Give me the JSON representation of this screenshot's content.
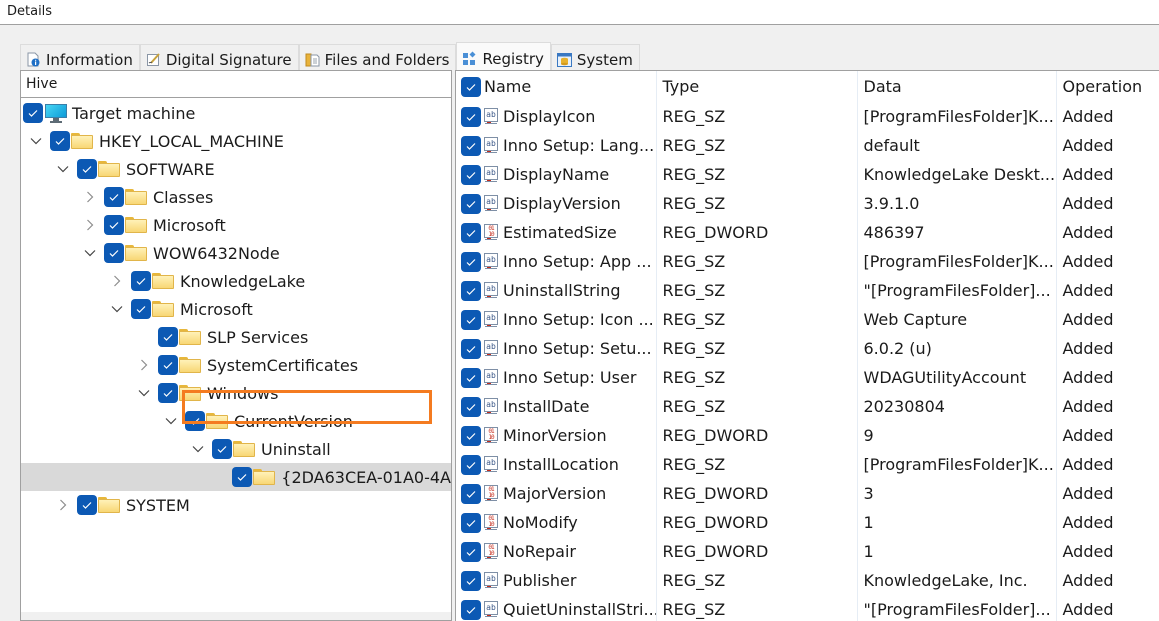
{
  "window": {
    "title": "Details"
  },
  "tabs": [
    {
      "label": "Information",
      "icon": "info-document-icon",
      "active": false
    },
    {
      "label": "Digital Signature",
      "icon": "signature-icon",
      "active": false
    },
    {
      "label": "Files and Folders",
      "icon": "files-folders-icon",
      "active": false
    },
    {
      "label": "Registry",
      "icon": "registry-icon",
      "active": true
    },
    {
      "label": "System",
      "icon": "system-database-icon",
      "active": false
    }
  ],
  "hive": {
    "header": "Hive",
    "nodes": [
      {
        "label": "Target machine",
        "level": 0,
        "expander": "none",
        "icon": "monitor-icon",
        "checked": true
      },
      {
        "label": "HKEY_LOCAL_MACHINE",
        "level": 1,
        "expander": "expanded",
        "icon": "folder-icon",
        "checked": true
      },
      {
        "label": "SOFTWARE",
        "level": 2,
        "expander": "expanded",
        "icon": "folder-icon",
        "checked": true
      },
      {
        "label": "Classes",
        "level": 3,
        "expander": "collapsed",
        "icon": "folder-icon",
        "checked": true
      },
      {
        "label": "Microsoft",
        "level": 3,
        "expander": "collapsed",
        "icon": "folder-icon",
        "checked": true
      },
      {
        "label": "WOW6432Node",
        "level": 3,
        "expander": "expanded",
        "icon": "folder-icon",
        "checked": true
      },
      {
        "label": "KnowledgeLake",
        "level": 4,
        "expander": "collapsed",
        "icon": "folder-icon",
        "checked": true
      },
      {
        "label": "Microsoft",
        "level": 4,
        "expander": "expanded",
        "icon": "folder-icon",
        "checked": true
      },
      {
        "label": "SLP Services",
        "level": 5,
        "expander": "none",
        "icon": "folder-icon",
        "checked": true
      },
      {
        "label": "SystemCertificates",
        "level": 5,
        "expander": "collapsed",
        "icon": "folder-icon",
        "checked": true
      },
      {
        "label": "Windows",
        "level": 5,
        "expander": "expanded",
        "icon": "folder-icon",
        "checked": true
      },
      {
        "label": "CurrentVersion",
        "level": 6,
        "expander": "expanded",
        "icon": "folder-icon",
        "checked": true
      },
      {
        "label": "Uninstall",
        "level": 7,
        "expander": "expanded",
        "icon": "folder-icon",
        "checked": true
      },
      {
        "label": "{2DA63CEA-01A0-4A",
        "level": 8,
        "expander": "none",
        "icon": "folder-icon",
        "checked": true,
        "selected": true
      },
      {
        "label": "SYSTEM",
        "level": 2,
        "expander": "collapsed",
        "icon": "folder-icon",
        "checked": true
      }
    ]
  },
  "registry": {
    "columns": [
      "Name",
      "Type",
      "Data",
      "Operation"
    ],
    "header_checked": true,
    "rows": [
      {
        "name": "DisplayIcon",
        "kind": "string",
        "type": "REG_SZ",
        "data": "[ProgramFilesFolder]K...",
        "operation": "Added"
      },
      {
        "name": "Inno Setup: Lang...",
        "kind": "string",
        "type": "REG_SZ",
        "data": "default",
        "operation": "Added"
      },
      {
        "name": "DisplayName",
        "kind": "string",
        "type": "REG_SZ",
        "data": "KnowledgeLake Deskt...",
        "operation": "Added"
      },
      {
        "name": "DisplayVersion",
        "kind": "string",
        "type": "REG_SZ",
        "data": "3.9.1.0",
        "operation": "Added"
      },
      {
        "name": "EstimatedSize",
        "kind": "dword",
        "type": "REG_DWORD",
        "data": "486397",
        "operation": "Added"
      },
      {
        "name": "Inno Setup: App ...",
        "kind": "string",
        "type": "REG_SZ",
        "data": "[ProgramFilesFolder]K...",
        "operation": "Added"
      },
      {
        "name": "UninstallString",
        "kind": "string",
        "type": "REG_SZ",
        "data": "\"[ProgramFilesFolder]...",
        "operation": "Added"
      },
      {
        "name": "Inno Setup: Icon ...",
        "kind": "string",
        "type": "REG_SZ",
        "data": "Web Capture",
        "operation": "Added"
      },
      {
        "name": "Inno Setup: Setu...",
        "kind": "string",
        "type": "REG_SZ",
        "data": "6.0.2 (u)",
        "operation": "Added"
      },
      {
        "name": "Inno Setup: User",
        "kind": "string",
        "type": "REG_SZ",
        "data": "WDAGUtilityAccount",
        "operation": "Added"
      },
      {
        "name": "InstallDate",
        "kind": "string",
        "type": "REG_SZ",
        "data": "20230804",
        "operation": "Added"
      },
      {
        "name": "MinorVersion",
        "kind": "dword",
        "type": "REG_DWORD",
        "data": "9",
        "operation": "Added"
      },
      {
        "name": "InstallLocation",
        "kind": "string",
        "type": "REG_SZ",
        "data": "[ProgramFilesFolder]K...",
        "operation": "Added"
      },
      {
        "name": "MajorVersion",
        "kind": "dword",
        "type": "REG_DWORD",
        "data": "3",
        "operation": "Added"
      },
      {
        "name": "NoModify",
        "kind": "dword",
        "type": "REG_DWORD",
        "data": "1",
        "operation": "Added"
      },
      {
        "name": "NoRepair",
        "kind": "dword",
        "type": "REG_DWORD",
        "data": "1",
        "operation": "Added"
      },
      {
        "name": "Publisher",
        "kind": "string",
        "type": "REG_SZ",
        "data": "KnowledgeLake, Inc.",
        "operation": "Added"
      },
      {
        "name": "QuietUninstallStri...",
        "kind": "string",
        "type": "REG_SZ",
        "data": "\"[ProgramFilesFolder]...",
        "operation": "Added"
      }
    ]
  },
  "colors": {
    "checkbox": "#0c59b4",
    "selection_outline": "#f47b20",
    "selected_row": "#d9d9d9"
  }
}
